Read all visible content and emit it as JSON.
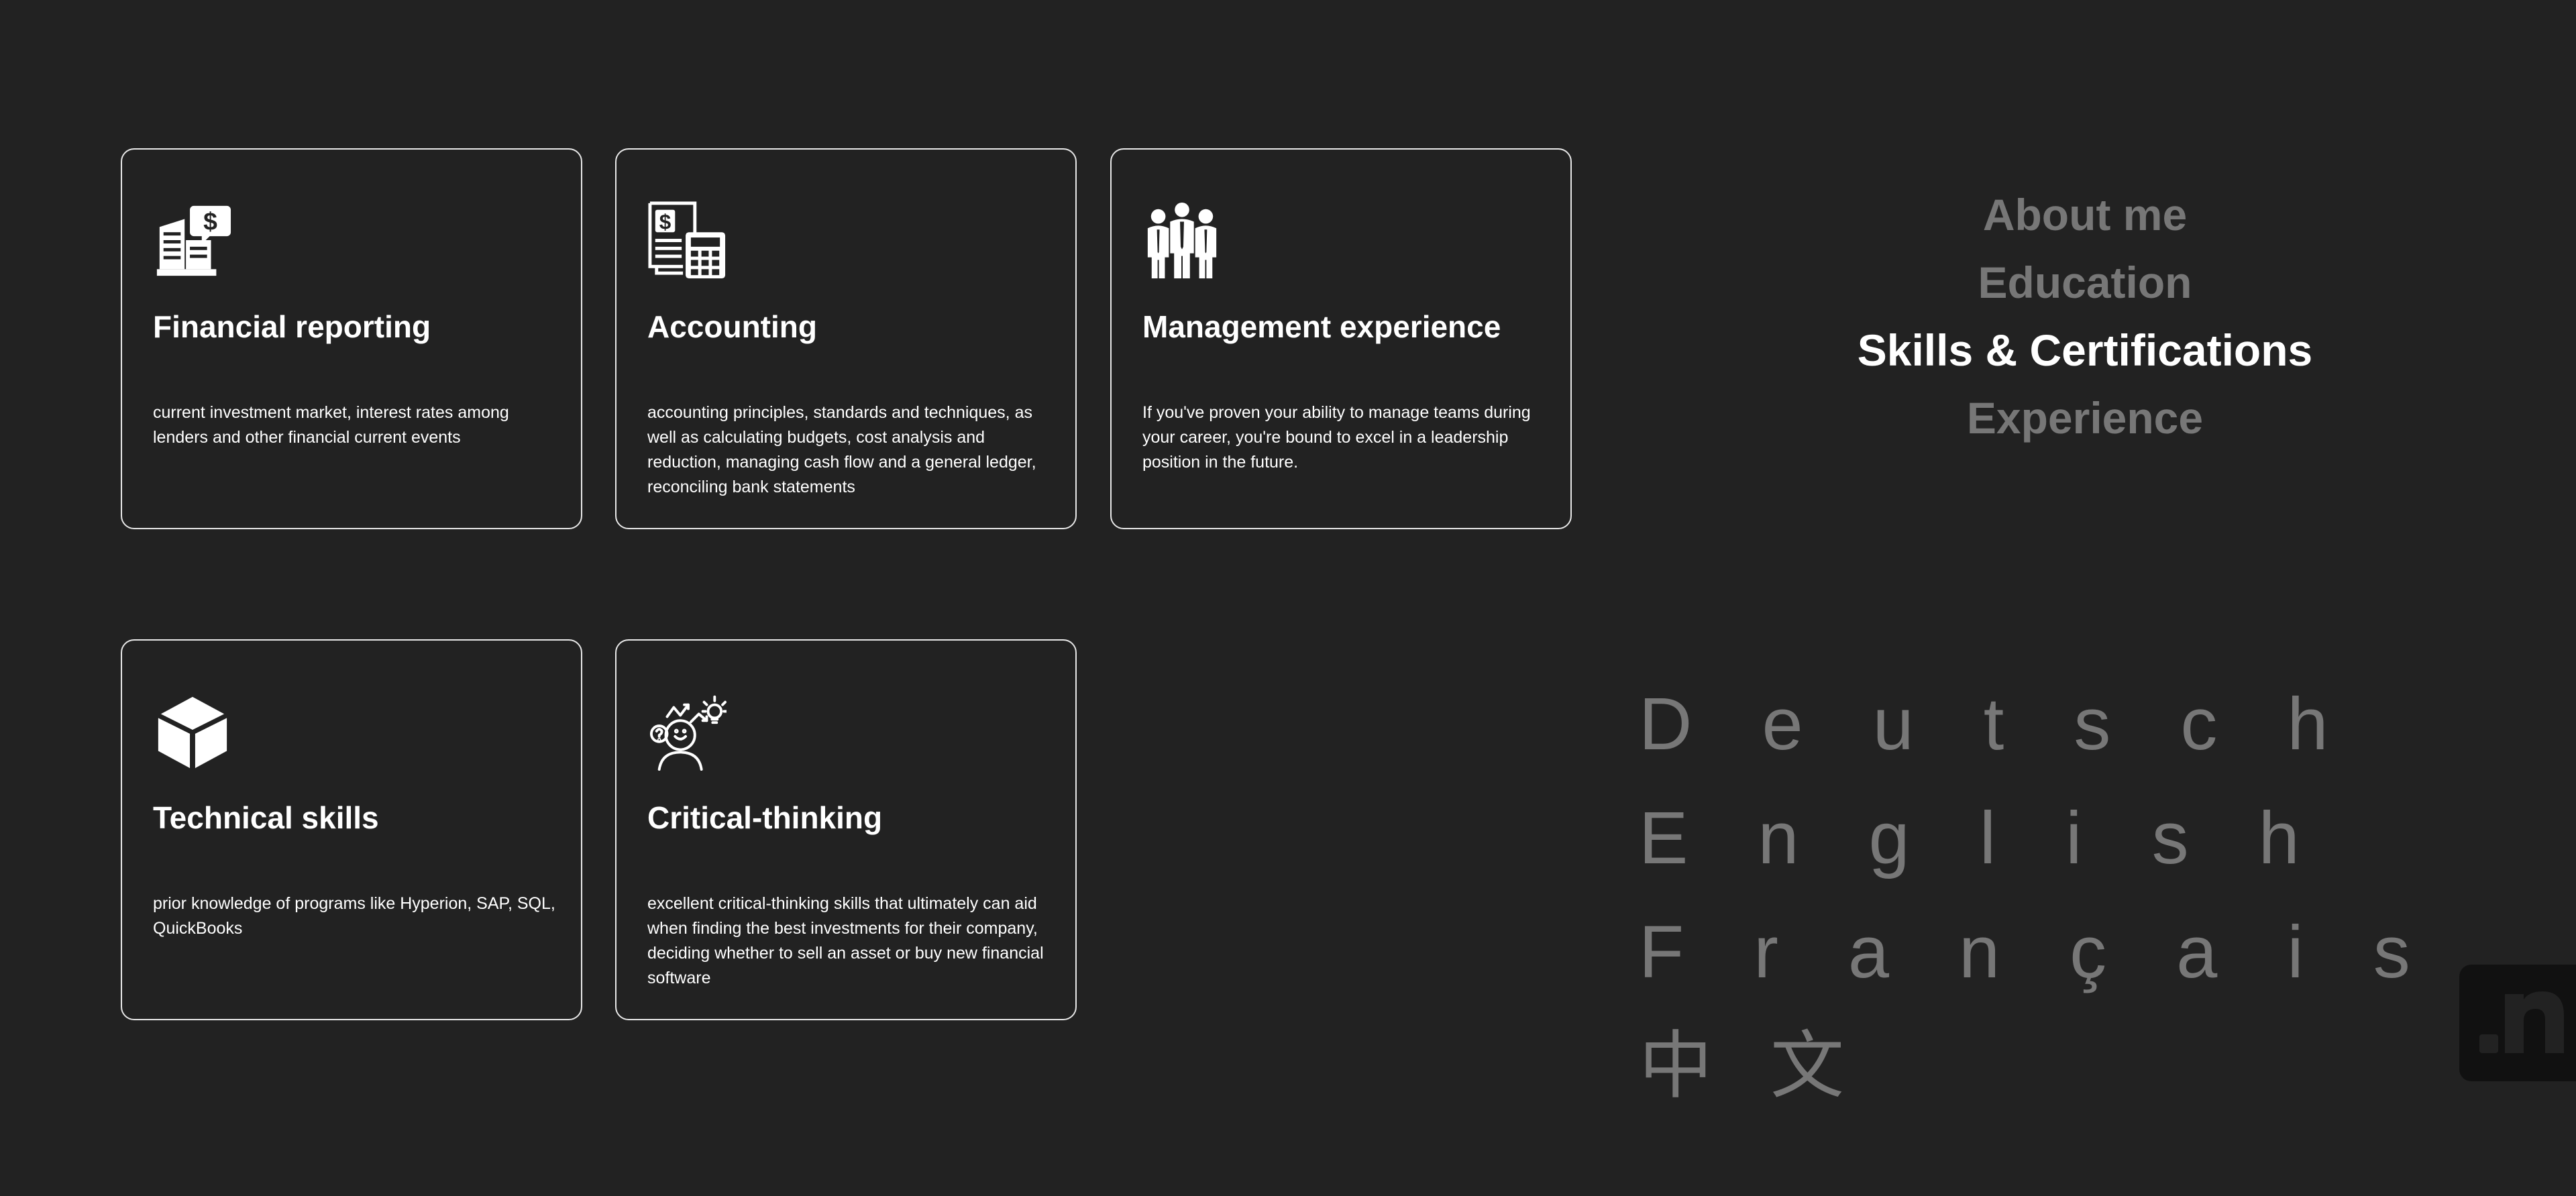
{
  "skills": [
    {
      "icon": "financial-report-building-icon",
      "title": "Financial reporting",
      "description": "current investment market, interest rates among lenders and other financial current events"
    },
    {
      "icon": "accounting-calculator-icon",
      "title": "Accounting",
      "description": "accounting principles, standards and techniques, as well as calculating budgets, cost analysis and reduction, managing cash flow and a general ledger, reconciling bank statements"
    },
    {
      "icon": "team-management-icon",
      "title": "Management experience",
      "description": "If you've proven your ability to manage teams during your career, you're bound to excel in a leadership position in the future."
    },
    {
      "icon": "cube-icon",
      "title": "Technical skills",
      "description": "prior knowledge of programs like Hyperion, SAP, SQL, QuickBooks"
    },
    {
      "icon": "critical-thinking-head-icon",
      "title": "Critical-thinking",
      "description": "excellent critical-thinking skills that ultimately can aid when finding the best investments for their company, deciding whether to sell an asset or buy new financial software"
    }
  ],
  "nav": {
    "items": [
      {
        "label": "About me"
      },
      {
        "label": "Education"
      },
      {
        "label": "Skills & Certifications"
      },
      {
        "label": "Experience"
      }
    ],
    "active_index": 2
  },
  "languages": [
    {
      "label": "Deutsch"
    },
    {
      "label": "English"
    },
    {
      "label": "Français"
    },
    {
      "label": "中文"
    }
  ],
  "colors": {
    "background": "#222222",
    "text": "#ffffff",
    "muted": "#777777",
    "card_border": "#e8e8e8"
  }
}
